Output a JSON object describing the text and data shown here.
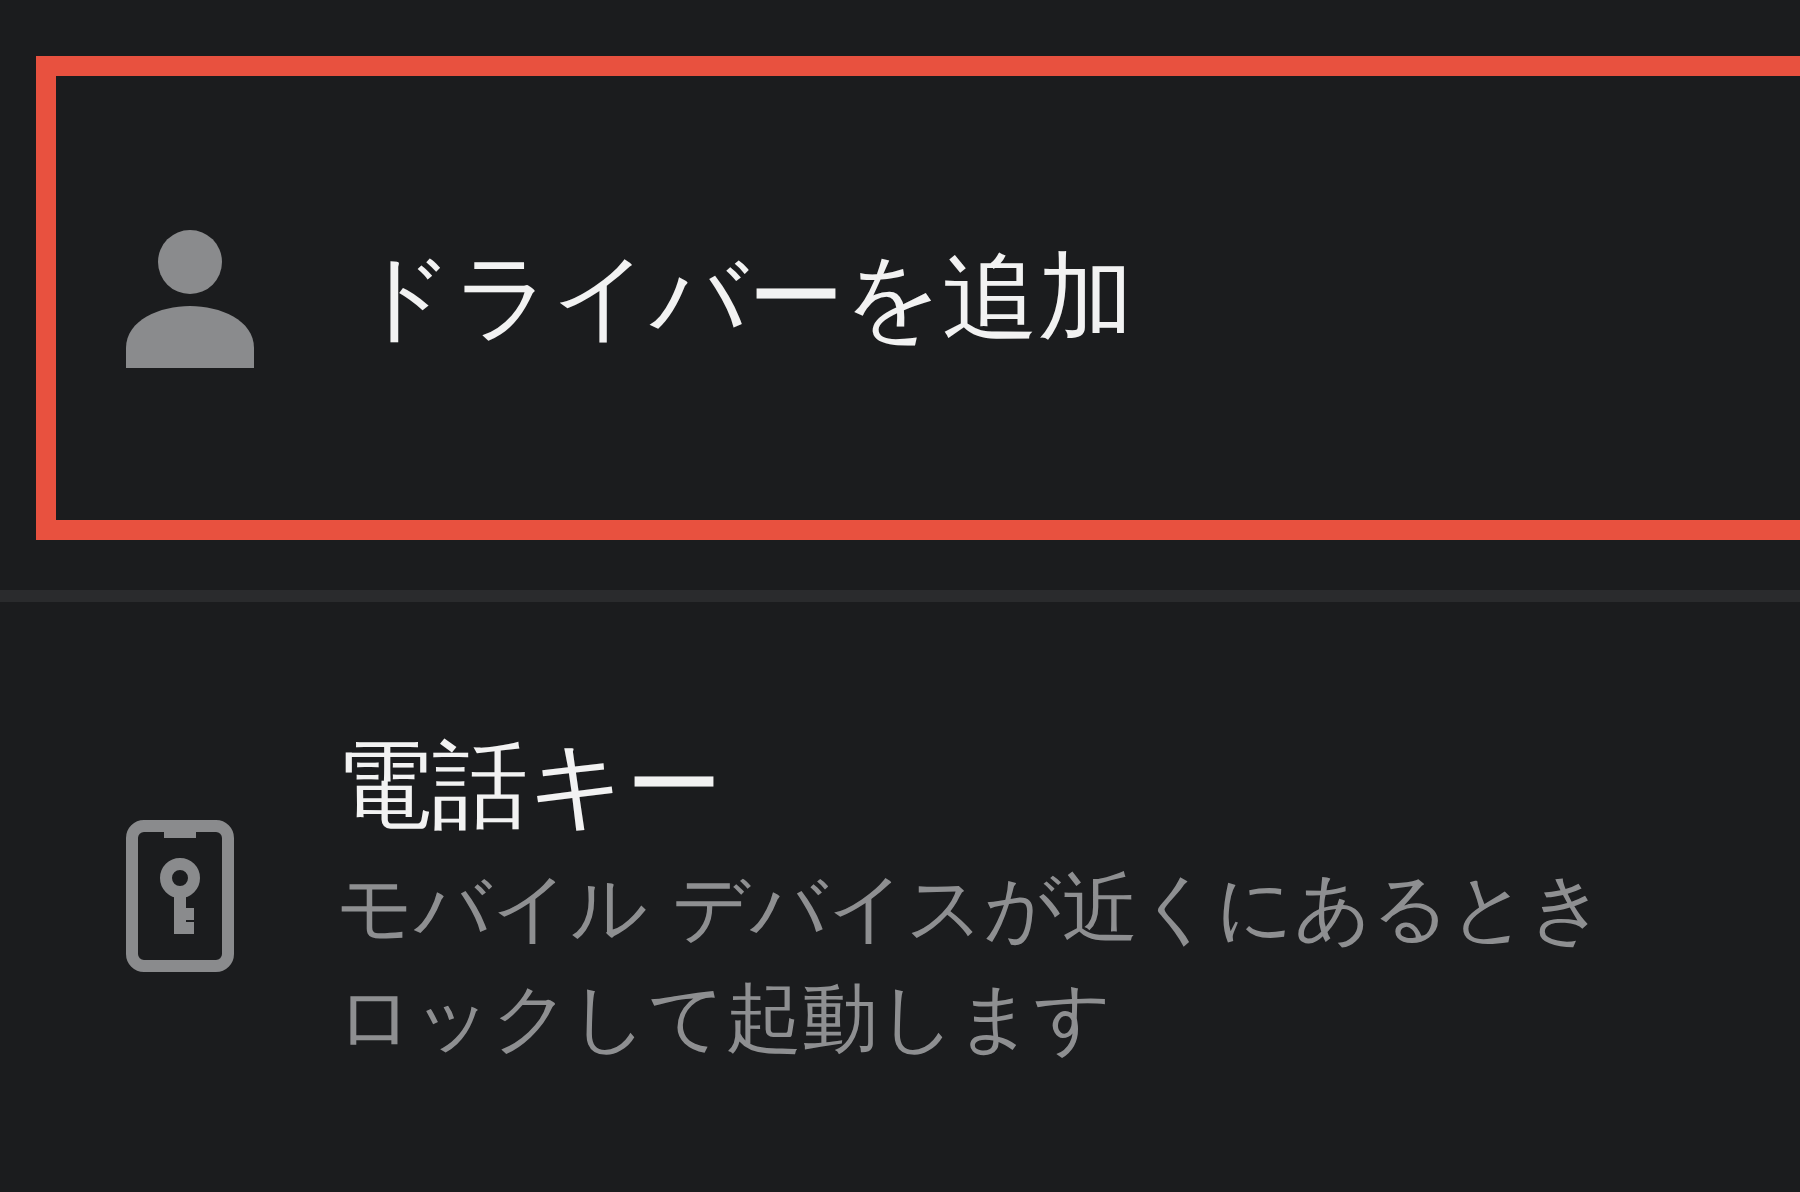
{
  "items": [
    {
      "kind": "driver",
      "title": "ドライバーを追加",
      "highlighted": true
    },
    {
      "kind": "phone_key",
      "title": "電話キー",
      "description_lines": [
        "モバイル デバイスが近くにあるとき",
        "ロックして起動します"
      ],
      "highlighted": false
    }
  ]
}
